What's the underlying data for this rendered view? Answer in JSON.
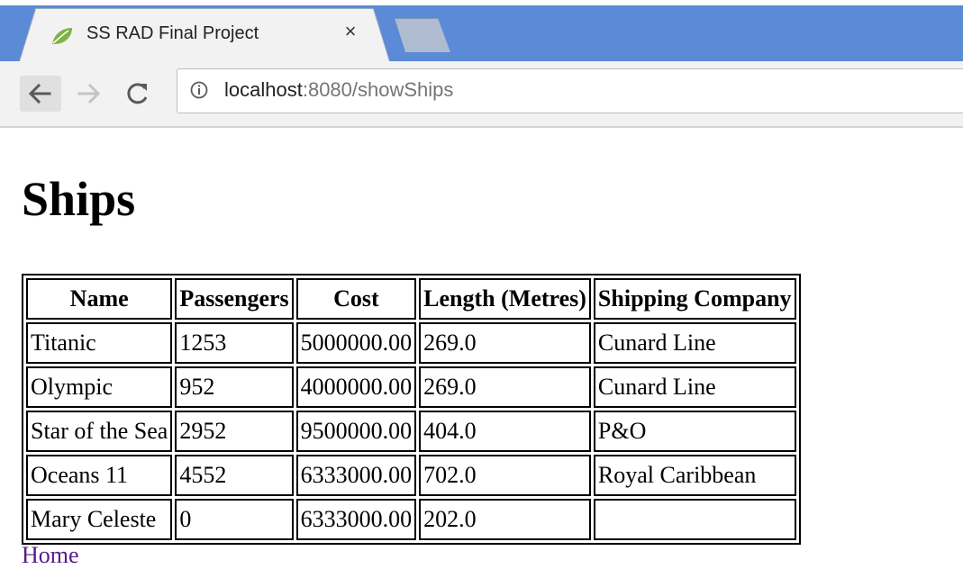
{
  "browser": {
    "tab_title": "SS RAD Final Project",
    "tab_close": "×",
    "url_host": "localhost",
    "url_rest": ":8080/showShips"
  },
  "page": {
    "title": "Ships",
    "home_link": "Home"
  },
  "table": {
    "headers": [
      "Name",
      "Passengers",
      "Cost",
      "Length (Metres)",
      "Shipping Company"
    ],
    "rows": [
      [
        "Titanic",
        "1253",
        "5000000.00",
        "269.0",
        "Cunard Line"
      ],
      [
        "Olympic",
        "952",
        "4000000.00",
        "269.0",
        "Cunard Line"
      ],
      [
        "Star of the Sea",
        "2952",
        "9500000.00",
        "404.0",
        "P&O"
      ],
      [
        "Oceans 11",
        "4552",
        "6333000.00",
        "702.0",
        "Royal Caribbean"
      ],
      [
        "Mary Celeste",
        "0",
        "6333000.00",
        "202.0",
        ""
      ]
    ]
  },
  "colors": {
    "tabstrip": "#5b8ad6",
    "link_visited": "#551a8b",
    "favicon": "#7cb342"
  },
  "icons": {
    "favicon": "spring-leaf-icon",
    "back": "arrow-left-icon",
    "forward": "arrow-right-icon",
    "reload": "reload-icon",
    "info": "info-icon"
  }
}
